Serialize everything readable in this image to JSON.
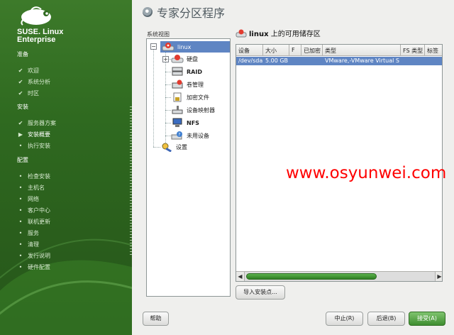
{
  "brand": {
    "line1": "SUSE. Linux",
    "line2": "Enterprise"
  },
  "sidebar": {
    "sections": [
      {
        "label": "准备",
        "items": [
          {
            "label": "欢迎",
            "state": "done"
          },
          {
            "label": "系统分析",
            "state": "done"
          },
          {
            "label": "时区",
            "state": "done"
          }
        ]
      },
      {
        "label": "安装",
        "items": [
          {
            "label": "服务器方案",
            "state": "done"
          },
          {
            "label": "安装概要",
            "state": "current"
          },
          {
            "label": "执行安装",
            "state": "todo"
          }
        ]
      },
      {
        "label": "配置",
        "items": [
          {
            "label": "检查安装",
            "state": "todo"
          },
          {
            "label": "主机名",
            "state": "todo"
          },
          {
            "label": "网络",
            "state": "todo"
          },
          {
            "label": "客户中心",
            "state": "todo"
          },
          {
            "label": "联机更新",
            "state": "todo"
          },
          {
            "label": "服务",
            "state": "todo"
          },
          {
            "label": "清理",
            "state": "todo"
          },
          {
            "label": "发行说明",
            "state": "todo"
          },
          {
            "label": "硬件配置",
            "state": "todo"
          }
        ]
      }
    ]
  },
  "page_title": "专家分区程序",
  "tree": {
    "label": "系统视图",
    "root": "linux",
    "children": [
      "硬盘",
      "RAID",
      "卷管理",
      "加密文件",
      "设备映射器",
      "NFS",
      "未用设备"
    ],
    "settings": "设置"
  },
  "panel": {
    "host": "linux",
    "title_suffix": " 上的可用储存区",
    "columns": [
      "设备",
      "大小",
      "F",
      "已加密",
      "类型",
      "FS 类型",
      "标签"
    ],
    "rows": [
      [
        "/dev/sda",
        "5.00 GB",
        "",
        "",
        "VMware,-VMware Virtual S",
        "",
        ""
      ]
    ]
  },
  "buttons": {
    "import": "导入安装点...",
    "help": "帮助",
    "abort": "中止(R)",
    "back": "后退(B)",
    "accept": "接受(A)"
  },
  "watermark": "www.osyunwei.com",
  "colors": {
    "sidebar_green": "#2f6a20",
    "selection_blue": "#5f85c3",
    "accept_green": "#3e8d2f",
    "watermark_red": "#ff0000"
  }
}
